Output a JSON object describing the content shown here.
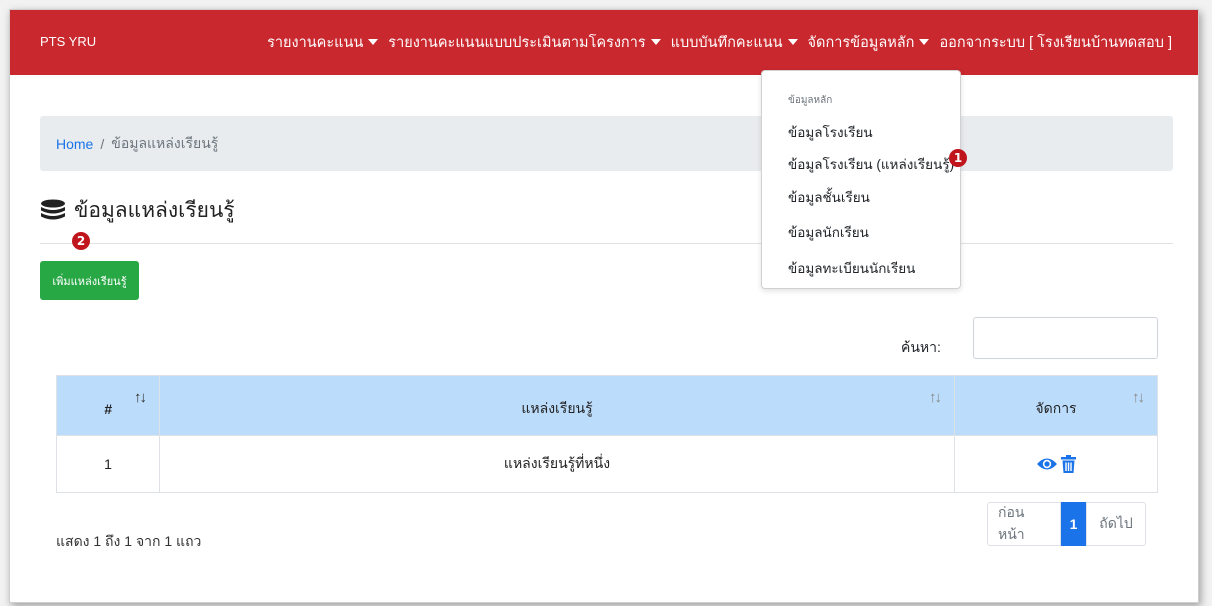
{
  "navbar": {
    "brand": "PTS YRU",
    "items": [
      {
        "label": "รายงานคะแนน",
        "caret": true
      },
      {
        "label": "รายงานคะแนนแบบประเมินตามโครงการ",
        "caret": true
      },
      {
        "label": "แบบบันทึกคะแนน",
        "caret": true
      },
      {
        "label": "จัดการข้อมูลหลัก",
        "caret": true
      },
      {
        "label": "ออกจากระบบ [ โรงเรียนบ้านทดสอบ ]",
        "caret": false
      }
    ],
    "color": "#c9282f"
  },
  "dropdown": {
    "header": "ข้อมูลหลัก",
    "items": [
      "ข้อมูลโรงเรียน",
      "ข้อมูลโรงเรียน (แหล่งเรียนรู้)",
      "ข้อมูลชั้นเรียน",
      "ข้อมูลนักเรียน",
      "ข้อมูลทะเบียนนักเรียน"
    ]
  },
  "breadcrumb": {
    "home": "Home",
    "separator": "/",
    "current": "ข้อมูลแหล่งเรียนรู้"
  },
  "page": {
    "title": "ข้อมูลแหล่งเรียนรู้",
    "add_button": "เพิ่มแหล่งเรียนรู้"
  },
  "callouts": {
    "one": "1",
    "two": "2"
  },
  "search": {
    "label": "ค้นหา:",
    "value": "",
    "placeholder": ""
  },
  "table": {
    "headers": [
      "#",
      "แหล่งเรียนรู้",
      "จัดการ"
    ],
    "rows": [
      {
        "num": "1",
        "name": "แหล่งเรียนรู้ที่หนึ่ง"
      }
    ]
  },
  "footer": {
    "info": "แสดง 1 ถึง 1 จาก 1 แถว",
    "prev": "ก่อนหน้า",
    "current_page": "1",
    "next": "ถัดไป"
  },
  "icons": {
    "title_icon": "database-icon",
    "view": "eye-icon",
    "delete": "trash-icon",
    "sort": "sort-arrows-icon"
  },
  "colors": {
    "accent": "#1a73e8",
    "add_button": "#28a745",
    "table_header": "#bcdcfb",
    "callout": "#c0151d"
  }
}
